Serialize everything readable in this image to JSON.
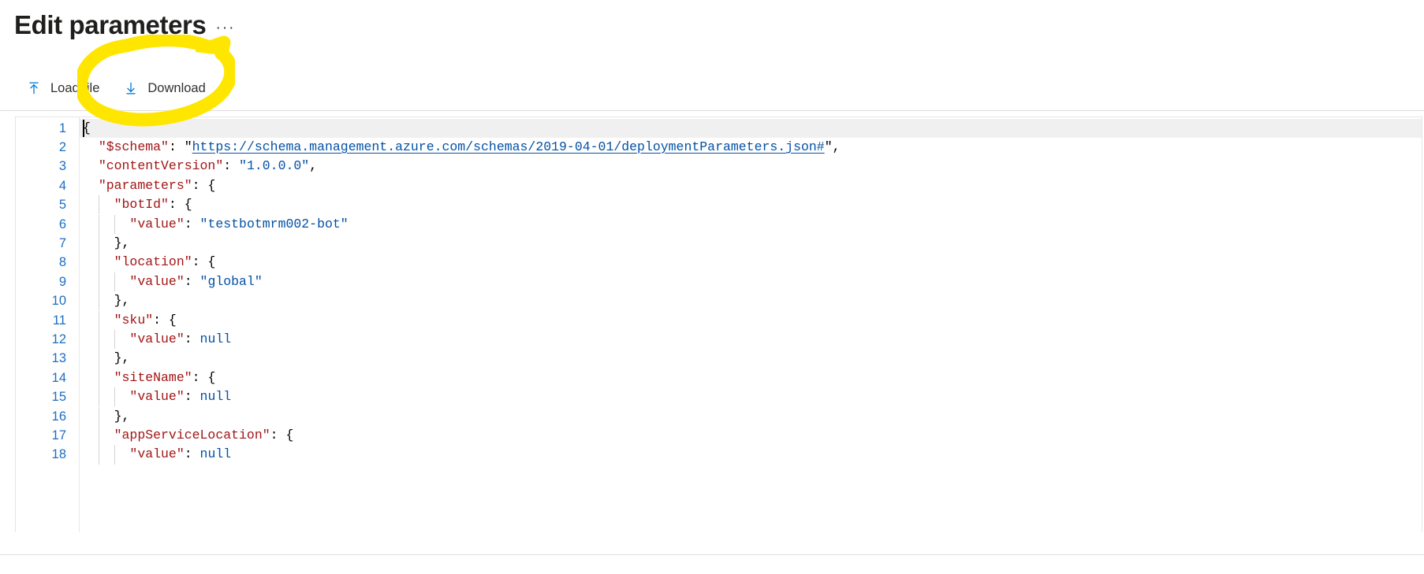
{
  "header": {
    "title": "Edit parameters",
    "more_menu_label": "···",
    "more_menu_name": "more-options"
  },
  "commandbar": {
    "buttons": [
      {
        "label": "Load file",
        "icon": "upload-icon"
      },
      {
        "label": "Download",
        "icon": "download-icon"
      }
    ]
  },
  "annotation": {
    "type": "hand-drawn-highlight-ellipse",
    "color": "#FFE600",
    "target": "Download"
  },
  "colors": {
    "accent": "#0078d4",
    "link": "#0451a5",
    "json_key": "#a31515",
    "json_string": "#0451a5",
    "line_number": "#1c6ec4",
    "highlight": "#FFE600"
  },
  "editor": {
    "language": "json",
    "cursor_line": 1,
    "cursor_column": 1,
    "first_visible_line": 1,
    "last_visible_line": 18,
    "lines": [
      {
        "n": "1",
        "indent": 0,
        "tokens": [
          {
            "t": "pun",
            "v": "{"
          }
        ]
      },
      {
        "n": "2",
        "indent": 1,
        "tokens": [
          {
            "t": "key",
            "v": "\"$schema\""
          },
          {
            "t": "pun",
            "v": ": "
          },
          {
            "t": "pun",
            "v": "\""
          },
          {
            "t": "link",
            "v": "https://schema.management.azure.com/schemas/2019-04-01/deploymentParameters.json#"
          },
          {
            "t": "pun",
            "v": "\","
          }
        ]
      },
      {
        "n": "3",
        "indent": 1,
        "tokens": [
          {
            "t": "key",
            "v": "\"contentVersion\""
          },
          {
            "t": "pun",
            "v": ": "
          },
          {
            "t": "str",
            "v": "\"1.0.0.0\""
          },
          {
            "t": "pun",
            "v": ","
          }
        ]
      },
      {
        "n": "4",
        "indent": 1,
        "tokens": [
          {
            "t": "key",
            "v": "\"parameters\""
          },
          {
            "t": "pun",
            "v": ": {"
          }
        ]
      },
      {
        "n": "5",
        "indent": 2,
        "tokens": [
          {
            "t": "key",
            "v": "\"botId\""
          },
          {
            "t": "pun",
            "v": ": {"
          }
        ]
      },
      {
        "n": "6",
        "indent": 3,
        "tokens": [
          {
            "t": "key",
            "v": "\"value\""
          },
          {
            "t": "pun",
            "v": ": "
          },
          {
            "t": "str",
            "v": "\"testbotmrm002-bot\""
          }
        ]
      },
      {
        "n": "7",
        "indent": 2,
        "tokens": [
          {
            "t": "pun",
            "v": "},"
          }
        ]
      },
      {
        "n": "8",
        "indent": 2,
        "tokens": [
          {
            "t": "key",
            "v": "\"location\""
          },
          {
            "t": "pun",
            "v": ": {"
          }
        ]
      },
      {
        "n": "9",
        "indent": 3,
        "tokens": [
          {
            "t": "key",
            "v": "\"value\""
          },
          {
            "t": "pun",
            "v": ": "
          },
          {
            "t": "str",
            "v": "\"global\""
          }
        ]
      },
      {
        "n": "10",
        "indent": 2,
        "tokens": [
          {
            "t": "pun",
            "v": "},"
          }
        ]
      },
      {
        "n": "11",
        "indent": 2,
        "tokens": [
          {
            "t": "key",
            "v": "\"sku\""
          },
          {
            "t": "pun",
            "v": ": {"
          }
        ]
      },
      {
        "n": "12",
        "indent": 3,
        "tokens": [
          {
            "t": "key",
            "v": "\"value\""
          },
          {
            "t": "pun",
            "v": ": "
          },
          {
            "t": "null",
            "v": "null"
          }
        ]
      },
      {
        "n": "13",
        "indent": 2,
        "tokens": [
          {
            "t": "pun",
            "v": "},"
          }
        ]
      },
      {
        "n": "14",
        "indent": 2,
        "tokens": [
          {
            "t": "key",
            "v": "\"siteName\""
          },
          {
            "t": "pun",
            "v": ": {"
          }
        ]
      },
      {
        "n": "15",
        "indent": 3,
        "tokens": [
          {
            "t": "key",
            "v": "\"value\""
          },
          {
            "t": "pun",
            "v": ": "
          },
          {
            "t": "null",
            "v": "null"
          }
        ]
      },
      {
        "n": "16",
        "indent": 2,
        "tokens": [
          {
            "t": "pun",
            "v": "},"
          }
        ]
      },
      {
        "n": "17",
        "indent": 2,
        "tokens": [
          {
            "t": "key",
            "v": "\"appServiceLocation\""
          },
          {
            "t": "pun",
            "v": ": {"
          }
        ]
      },
      {
        "n": "18",
        "indent": 3,
        "tokens": [
          {
            "t": "key",
            "v": "\"value\""
          },
          {
            "t": "pun",
            "v": ": "
          },
          {
            "t": "null",
            "v": "null"
          }
        ]
      }
    ]
  }
}
